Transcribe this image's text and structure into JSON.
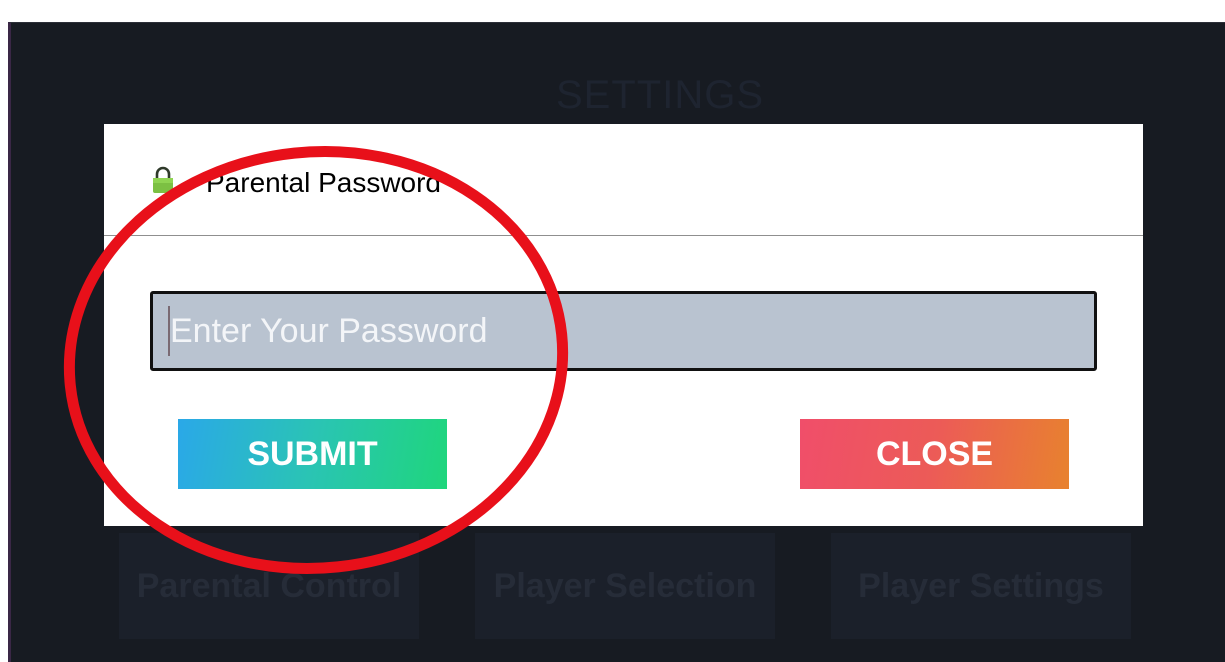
{
  "background": {
    "title": "SETTINGS",
    "tiles": [
      {
        "label": "Parental Control"
      },
      {
        "label": "Player Selection"
      },
      {
        "label": "Player Settings"
      }
    ]
  },
  "dialog": {
    "icon": "lock-icon",
    "title": "Parental Password",
    "password_placeholder": "Enter Your Password",
    "password_value": "",
    "submit_label": "SUBMIT",
    "close_label": "CLOSE"
  },
  "colors": {
    "screen_bg": "#171b22",
    "submit_gradient": [
      "#2aa8e8",
      "#1fd67c"
    ],
    "close_gradient": [
      "#f04e6a",
      "#e8822e"
    ],
    "annotation": "#e8101a",
    "lock_icon": "#7cc043"
  }
}
